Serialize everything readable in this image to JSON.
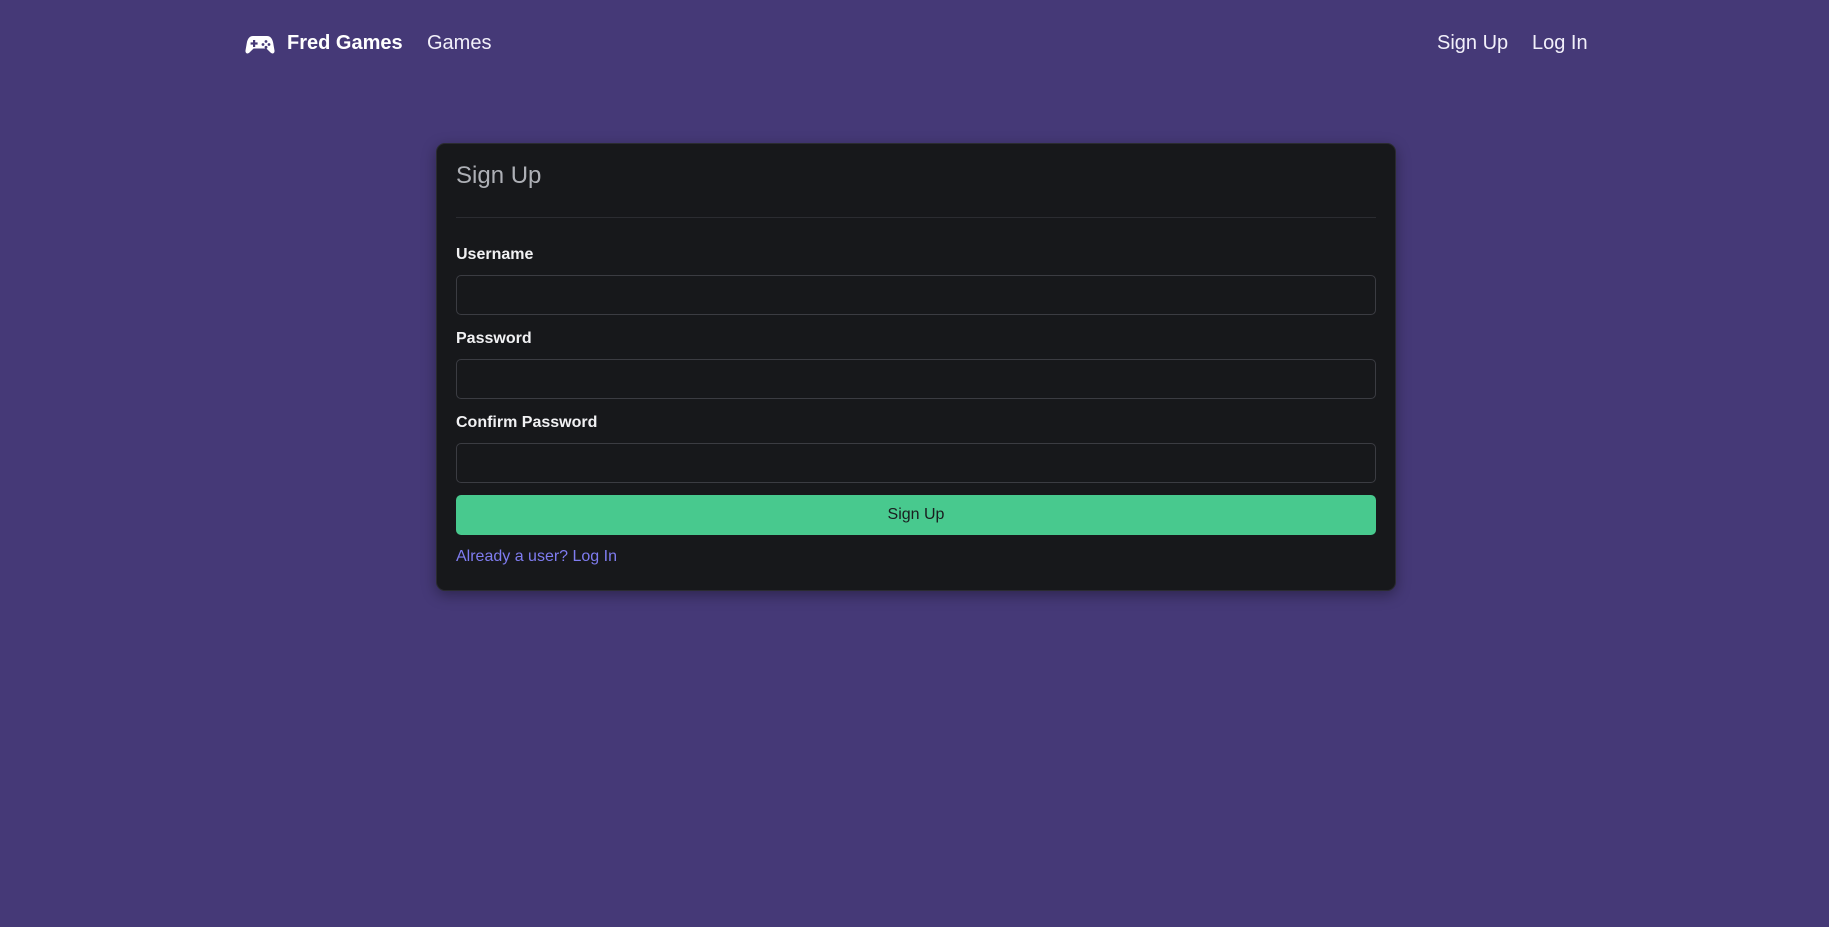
{
  "navbar": {
    "brand_icon": "gamepad-icon",
    "brand_name": "Fred Games",
    "links_left": [
      "Games"
    ],
    "links_right": [
      "Sign Up",
      "Log In"
    ]
  },
  "card": {
    "title": "Sign Up",
    "fields": [
      {
        "label": "Username",
        "value": "",
        "placeholder": ""
      },
      {
        "label": "Password",
        "value": "",
        "placeholder": ""
      },
      {
        "label": "Confirm Password",
        "value": "",
        "placeholder": ""
      }
    ],
    "submit_label": "Sign Up",
    "login_prompt": "Already a user? Log In"
  },
  "colors": {
    "background": "#453977",
    "card": "#17181b",
    "accent_button": "#48c98e",
    "link": "#7f7cf0"
  }
}
